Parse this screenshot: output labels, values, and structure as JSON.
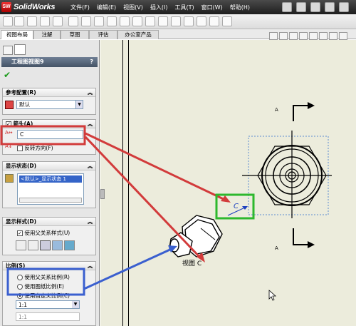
{
  "app": {
    "logo_text": "SolidWorks",
    "logo_mark": "SW"
  },
  "menu": [
    "文件(F)",
    "编辑(E)",
    "视图(V)",
    "插入(I)",
    "工具(T)",
    "窗口(W)",
    "帮助(H)"
  ],
  "tabs": [
    "视图布局",
    "注解",
    "草图",
    "评估",
    "办公室产品"
  ],
  "panel": {
    "title": "工程图视图9",
    "help_label": "?",
    "ok_glyph": "✔",
    "ref_config": {
      "header": "参考配置(R)",
      "value": "默认"
    },
    "arrow": {
      "header": "箭头(A)",
      "label_value": "C",
      "reverse_label": "反转方向(F)"
    },
    "display_state": {
      "header": "显示状态(D)",
      "item": "<默认>_显示状态 1"
    },
    "display_style": {
      "header": "显示样式(D)",
      "use_parent_label": "使用父关系样式(U)"
    },
    "scale": {
      "header": "比例(S)",
      "options": [
        "使用父关系比例(R)",
        "使用图纸比例(E)",
        "使用自定义比例(C)"
      ],
      "selected_index": 2,
      "value": "1:1",
      "custom_value": "1:1"
    }
  },
  "drawing": {
    "view_label": "视图 C",
    "arrow_label_top": "A",
    "arrow_label_bottom": "A",
    "arrow_letter": "C"
  },
  "colors": {
    "annotation_red": "#d23b3b",
    "annotation_green": "#2db82d",
    "annotation_blue": "#3a5fcf",
    "title_bar": "#2a2a2a"
  }
}
